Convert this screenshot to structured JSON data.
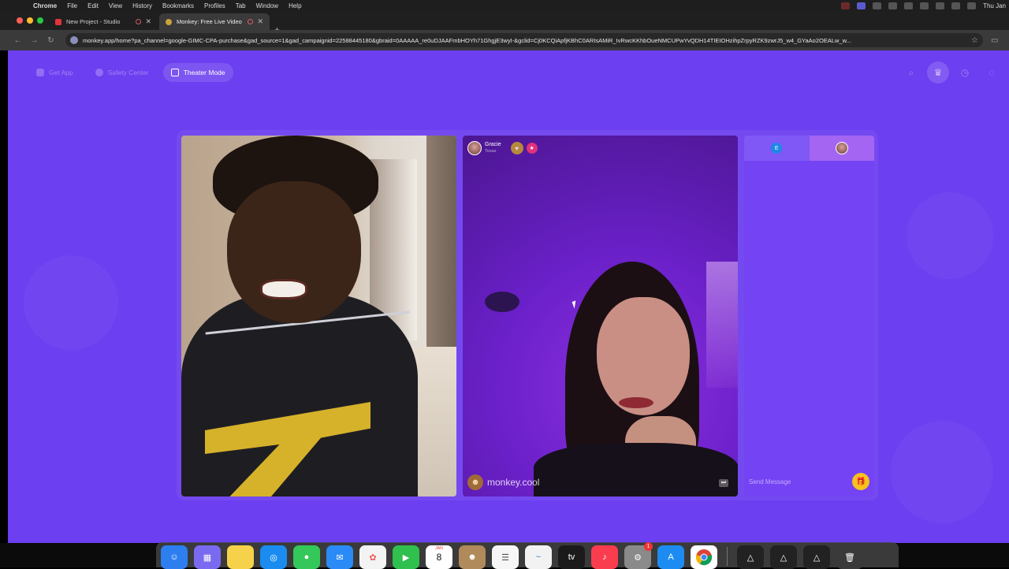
{
  "menubar": {
    "app": "Chrome",
    "items": [
      "File",
      "Edit",
      "View",
      "History",
      "Bookmarks",
      "Profiles",
      "Tab",
      "Window",
      "Help"
    ],
    "clock": "Thu Jan"
  },
  "browser": {
    "tabs": [
      {
        "title": "New Project - Studio",
        "favicon": "studio-icon"
      },
      {
        "title": "Monkey: Free Live Video",
        "favicon": "monkey-icon"
      }
    ],
    "url": "monkey.app/home?pa_channel=google-GIMC-CPA-purchase&gad_source=1&gad_campaignid=22588445180&gbraid=0AAAAA_re0uDJAAFmbHOYh71GhgjE3wyI-&gclid=Cj0KCQiApfjKBhC0ARIsAMiR_IvRwcKKhbOueNMCUPwYvQDH14TIEIOHzihpZrpyRZK9zwrJ5_w4_GYaAo2OEALw_w..."
  },
  "page": {
    "nav": {
      "get_app": "Get App",
      "safety_center": "Safety Center",
      "theater_mode": "Theater Mode"
    },
    "partner": {
      "name": "Gracie",
      "location": "Texas"
    },
    "watermark": "monkey.cool",
    "chat": {
      "me_initial": "E",
      "placeholder": "Send Message"
    }
  },
  "dock": {
    "calendar_month": "JAN",
    "calendar_day": "8",
    "settings_badge": "1"
  },
  "colors": {
    "page_bg": "#6c3ff0",
    "chat_panel": "#7443f4",
    "gift_button": "#f7c21a"
  }
}
